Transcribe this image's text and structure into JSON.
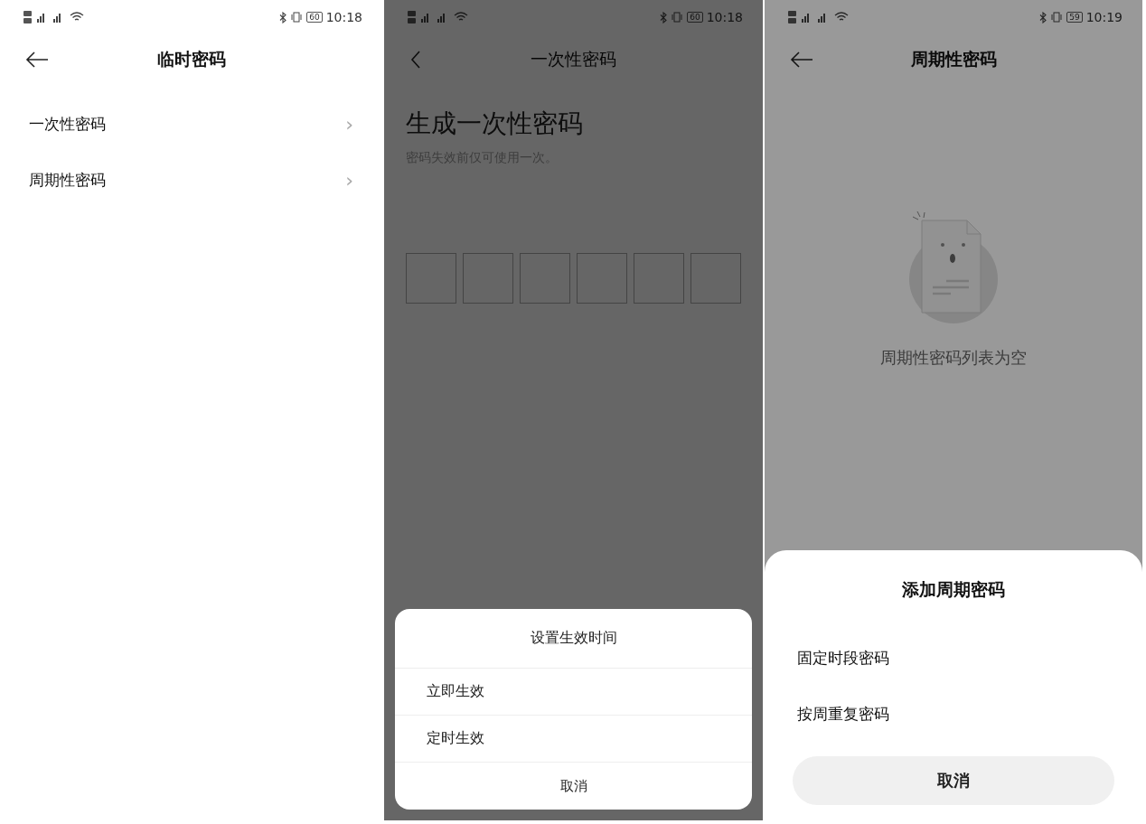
{
  "screens": [
    {
      "kind": "menu",
      "status": {
        "time": "10:18",
        "battery": "60"
      },
      "header": {
        "back": {
          "kind": "arrow"
        },
        "title": "临时密码",
        "bold": true
      },
      "items": [
        {
          "label": "一次性密码",
          "chevron": "›"
        },
        {
          "label": "周期性密码",
          "chevron": "›"
        }
      ]
    },
    {
      "kind": "code",
      "overlay": {
        "kind": "dark"
      },
      "status": {
        "time": "10:18",
        "battery": "60"
      },
      "header": {
        "back": {
          "kind": "chevron"
        },
        "title": "一次性密码",
        "bold": false
      },
      "heading": "生成一次性密码",
      "description": "密码失效前仅可使用一次。",
      "sheet": {
        "kind": "floating",
        "title": "设置生效时间",
        "options": [
          "立即生效",
          "定时生效"
        ],
        "cancel": "取消"
      }
    },
    {
      "kind": "empty",
      "overlay": {
        "kind": "light"
      },
      "status": {
        "time": "10:19",
        "battery": "59"
      },
      "header": {
        "back": {
          "kind": "arrow"
        },
        "title": "周期性密码",
        "bold": true
      },
      "empty_text": "周期性密码列表为空",
      "sheet": {
        "kind": "docked",
        "title": "添加周期密码",
        "options": [
          "固定时段密码",
          "按周重复密码"
        ],
        "cancel": "取消"
      }
    }
  ]
}
